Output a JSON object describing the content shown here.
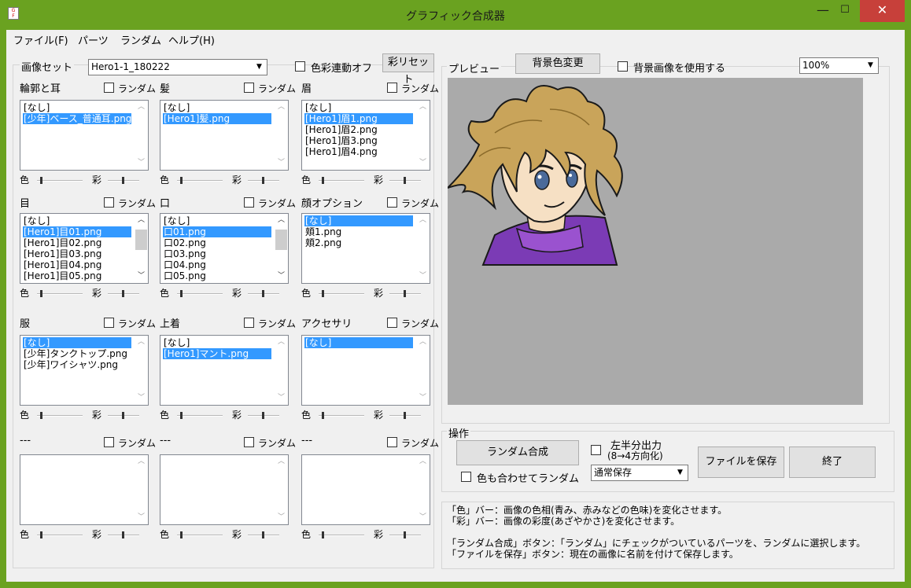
{
  "window": {
    "title": "グラフィック合成器",
    "min_glyph": "—",
    "max_glyph": "☐",
    "close_glyph": "✕"
  },
  "menu": [
    "ファイル(F)",
    "パーツ",
    "ランダム",
    "ヘルプ(H)"
  ],
  "image_set": {
    "label": "画像セット",
    "value": "Hero1-1_180222",
    "sync_label": "色彩連動オフ",
    "reset_label": "彩リセット"
  },
  "common": {
    "random": "ランダム",
    "hue": "色",
    "sat": "彩"
  },
  "parts": [
    {
      "name": "輪郭と耳",
      "items": [
        "[なし]",
        "[少年]ベース_普通耳.png"
      ],
      "selected": 1
    },
    {
      "name": "髪",
      "items": [
        "[なし]",
        "[Hero1]髪.png"
      ],
      "selected": 1
    },
    {
      "name": "眉",
      "items": [
        "[なし]",
        "[Hero1]眉1.png",
        "[Hero1]眉2.png",
        "[Hero1]眉3.png",
        "[Hero1]眉4.png"
      ],
      "selected": 1
    },
    {
      "name": "目",
      "items": [
        "[なし]",
        "[Hero1]目01.png",
        "[Hero1]目02.png",
        "[Hero1]目03.png",
        "[Hero1]目04.png",
        "[Hero1]目05.png"
      ],
      "selected": 1
    },
    {
      "name": "口",
      "items": [
        "[なし]",
        "口01.png",
        "口02.png",
        "口03.png",
        "口04.png",
        "口05.png"
      ],
      "selected": 1
    },
    {
      "name": "顔オプション",
      "items": [
        "[なし]",
        "頬1.png",
        "頬2.png"
      ],
      "selected": 0
    },
    {
      "name": "服",
      "items": [
        "[なし]",
        "[少年]タンクトップ.png",
        "[少年]ワイシャツ.png"
      ],
      "selected": 0
    },
    {
      "name": "上着",
      "items": [
        "[なし]",
        "[Hero1]マント.png"
      ],
      "selected": 1
    },
    {
      "name": "アクセサリ",
      "items": [
        "[なし]"
      ],
      "selected": 0
    },
    {
      "name": "---",
      "items": [],
      "selected": -1
    },
    {
      "name": "---",
      "items": [],
      "selected": -1
    },
    {
      "name": "---",
      "items": [],
      "selected": -1
    }
  ],
  "preview": {
    "label": "プレビュー",
    "bg_button": "背景色変更",
    "use_bg_label": "背景画像を使用する",
    "zoom": "100%",
    "bg_color": "#aaaaaa"
  },
  "operations": {
    "label": "操作",
    "random_compose": "ランダム合成",
    "random_with_color": "色も合わせてランダム",
    "half_output_line1": "左半分出力",
    "half_output_line2": "(8→4方向化)",
    "save_mode": "通常保存",
    "save_file": "ファイルを保存",
    "exit": "終了"
  },
  "help": [
    "「色」バー：画像の色相(青み、赤みなどの色味)を変化させます。",
    "「彩」バー：画像の彩度(あざやかさ)を変化させます。",
    "",
    "「ランダム合成」ボタン：「ランダム」にチェックがついているパーツを、ランダムに選択します。",
    "「ファイルを保存」ボタン：現在の画像に名前を付けて保存します。"
  ]
}
